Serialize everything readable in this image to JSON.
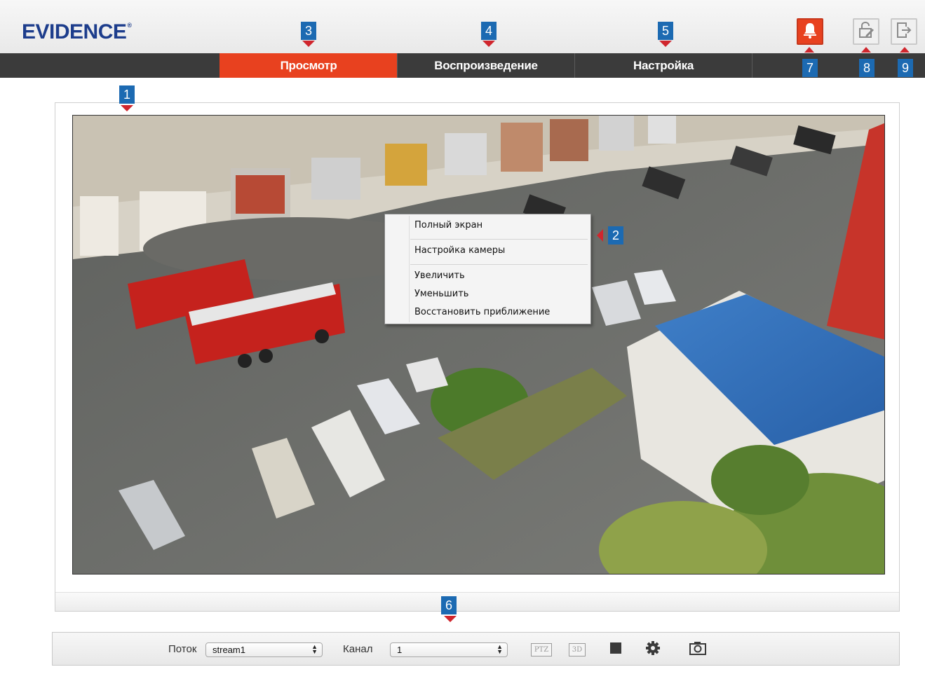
{
  "header": {
    "logo": "EVIDENCE",
    "logo_mark": "®",
    "buttons": [
      {
        "name": "alarm",
        "icon": "bell-icon",
        "color": "#e8411f"
      },
      {
        "name": "change-password",
        "icon": "lock-edit-icon"
      },
      {
        "name": "logout",
        "icon": "logout-icon"
      }
    ]
  },
  "nav": {
    "tabs": [
      {
        "label": "Просмотр",
        "active": true
      },
      {
        "label": "Воспроизведение",
        "active": false
      },
      {
        "label": "Настройка",
        "active": false
      }
    ]
  },
  "callouts": [
    "1",
    "2",
    "3",
    "4",
    "5",
    "6",
    "7",
    "8",
    "9"
  ],
  "context_menu": {
    "items": [
      "Полный экран",
      "Настройка камеры",
      "Увеличить",
      "Уменьшить",
      "Восстановить приближение"
    ]
  },
  "toolbar": {
    "stream_label": "Поток",
    "stream_value": "stream1",
    "channel_label": "Канал",
    "channel_value": "1",
    "ptz_label": "PTZ",
    "threed_label": "3D",
    "icons": [
      "stop-record-icon",
      "gear-icon",
      "camera-icon"
    ]
  },
  "colors": {
    "accent": "#e8411f",
    "brand": "#1d3d8c",
    "callout": "#1c6ab2",
    "nav_bg": "#3b3b3b"
  }
}
